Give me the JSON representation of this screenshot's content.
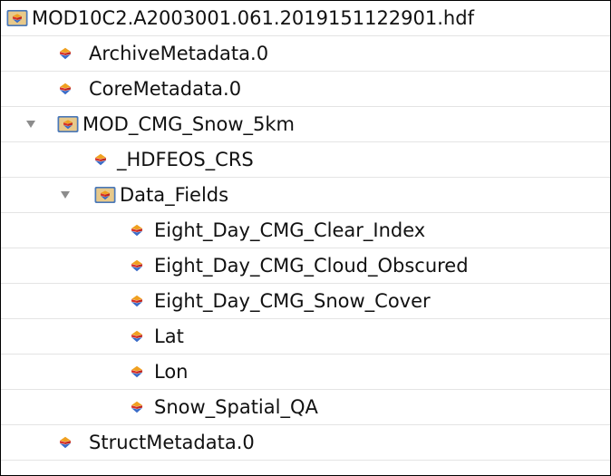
{
  "tree": {
    "root": {
      "label": "MOD10C2.A2003001.061.2019151122901.hdf",
      "icon": "hdf-file-group-icon"
    },
    "items": [
      {
        "label": "ArchiveMetadata.0",
        "icon": "attribute-icon"
      },
      {
        "label": "CoreMetadata.0",
        "icon": "attribute-icon"
      },
      {
        "label": "MOD_CMG_Snow_5km",
        "icon": "group-folder-icon",
        "expanded": true
      },
      {
        "label": "_HDFEOS_CRS",
        "icon": "attribute-icon"
      },
      {
        "label": "Data_Fields",
        "icon": "group-folder-icon",
        "expanded": true
      },
      {
        "label": "Eight_Day_CMG_Clear_Index",
        "icon": "dataset-icon"
      },
      {
        "label": "Eight_Day_CMG_Cloud_Obscured",
        "icon": "dataset-icon"
      },
      {
        "label": "Eight_Day_CMG_Snow_Cover",
        "icon": "dataset-icon"
      },
      {
        "label": "Lat",
        "icon": "dataset-icon"
      },
      {
        "label": "Lon",
        "icon": "dataset-icon"
      },
      {
        "label": "Snow_Spatial_QA",
        "icon": "dataset-icon"
      },
      {
        "label": "StructMetadata.0",
        "icon": "attribute-icon"
      }
    ]
  },
  "colors": {
    "folder_blue": "#4a78b8",
    "folder_tan": "#e8c98a",
    "hdf_orange": "#f0a020",
    "hdf_red": "#d8322a",
    "hdf_blue": "#3a6cc8",
    "disclosure_gray": "#8c8c8c"
  }
}
